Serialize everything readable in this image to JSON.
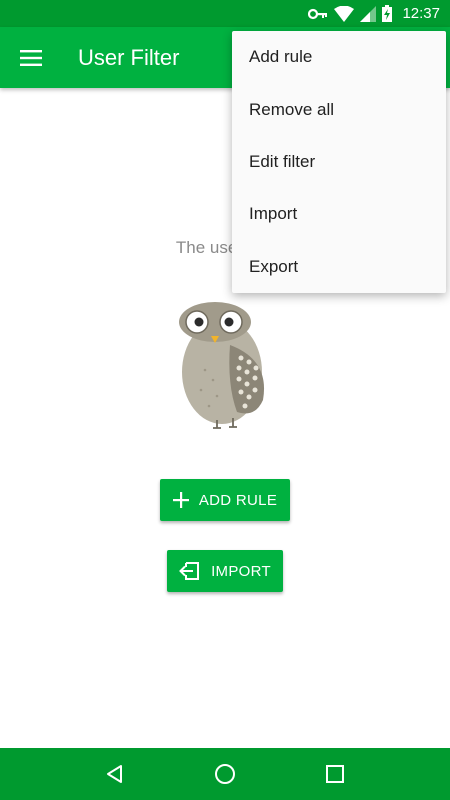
{
  "status_bar": {
    "time": "12:37",
    "icons": [
      "vpn-key-icon",
      "wifi-icon",
      "cell-signal-icon",
      "battery-charging-icon"
    ]
  },
  "app_bar": {
    "title": "User Filter",
    "menu_icon": "hamburger-menu-icon"
  },
  "main": {
    "empty_message": "The user filte",
    "illustration": "owl-illustration",
    "add_rule_label": "ADD RULE",
    "import_label": "IMPORT"
  },
  "overflow_menu": {
    "items": [
      {
        "label": "Add rule"
      },
      {
        "label": "Remove all"
      },
      {
        "label": "Edit filter"
      },
      {
        "label": "Import"
      },
      {
        "label": "Export"
      }
    ]
  },
  "nav_bar": {
    "icons": [
      "back-icon",
      "home-icon",
      "recents-icon"
    ]
  },
  "colors": {
    "primary": "#00b140",
    "primary_dark": "#009a2f",
    "menu_bg": "#fafafa",
    "empty_text": "#8a8a8a"
  }
}
